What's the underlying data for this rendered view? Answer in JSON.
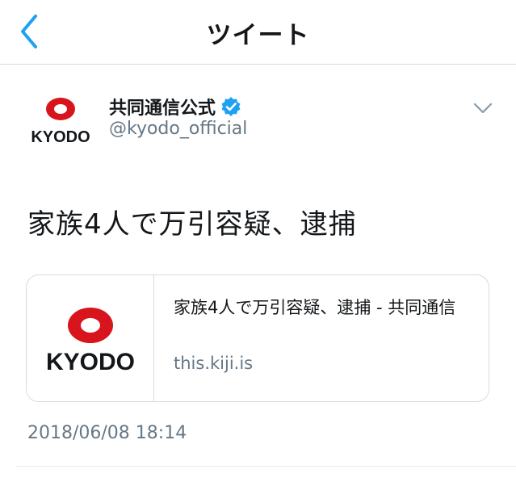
{
  "header": {
    "title": "ツイート",
    "back_icon": "chevron-left-icon"
  },
  "author": {
    "display_name": "共同通信公式",
    "handle": "@kyodo_official",
    "verified": true,
    "avatar_wordmark": "KYODO"
  },
  "tweet": {
    "text": "家族4人で万引容疑、逮捕",
    "timestamp": "2018/06/08 18:14"
  },
  "card": {
    "title": "家族4人で万引容疑、逮捕 - 共同通信",
    "domain": "this.kiji.is",
    "thumbnail_wordmark": "KYODO"
  },
  "colors": {
    "accent": "#1da1f2",
    "kyodo_red": "#d8141c",
    "secondary_text": "#657786",
    "divider": "#d6dade"
  }
}
